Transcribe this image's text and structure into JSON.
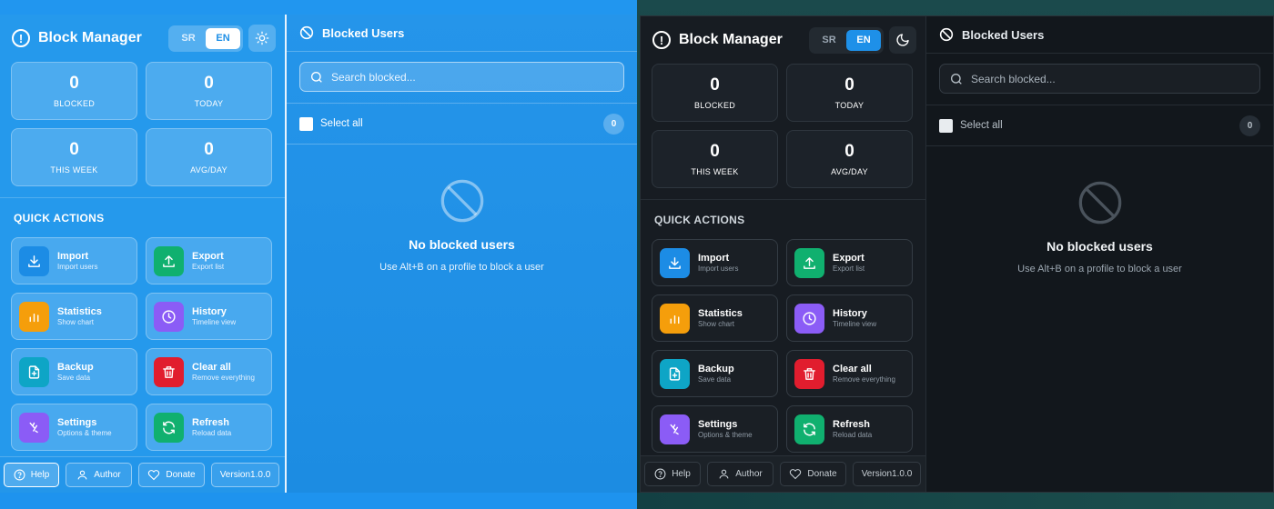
{
  "app": {
    "title": "Block Manager",
    "lang_sr": "SR",
    "lang_en": "EN"
  },
  "stats": [
    {
      "value": "0",
      "label": "BLOCKED"
    },
    {
      "value": "0",
      "label": "TODAY"
    },
    {
      "value": "0",
      "label": "THIS WEEK"
    },
    {
      "value": "0",
      "label": "AVG/DAY"
    }
  ],
  "quick_actions": {
    "title": "QUICK ACTIONS",
    "items": [
      {
        "title": "Import",
        "sub": "Import users",
        "icon": "download-icon",
        "color": "#1c8ce5"
      },
      {
        "title": "Export",
        "sub": "Export list",
        "icon": "upload-icon",
        "color": "#10b06f"
      },
      {
        "title": "Statistics",
        "sub": "Show chart",
        "icon": "bar-chart-icon",
        "color": "#f59e0b"
      },
      {
        "title": "History",
        "sub": "Timeline view",
        "icon": "clock-icon",
        "color": "#8b5cf6"
      },
      {
        "title": "Backup",
        "sub": "Save data",
        "icon": "file-plus-icon",
        "color": "#0ea5c6"
      },
      {
        "title": "Clear all",
        "sub": "Remove everything",
        "icon": "trash-icon",
        "color": "#e11d2e"
      },
      {
        "title": "Settings",
        "sub": "Options & theme",
        "icon": "tools-icon",
        "color": "#8b5cf6"
      },
      {
        "title": "Refresh",
        "sub": "Reload data",
        "icon": "refresh-icon",
        "color": "#10b06f"
      }
    ]
  },
  "footer": {
    "help": "Help",
    "author": "Author",
    "donate": "Donate",
    "version": "Version1.0.0"
  },
  "main": {
    "title": "Blocked Users",
    "search_placeholder": "Search blocked...",
    "select_all": "Select all",
    "count": "0",
    "empty_title": "No blocked users",
    "empty_sub": "Use Alt+B on a profile to block a user"
  }
}
